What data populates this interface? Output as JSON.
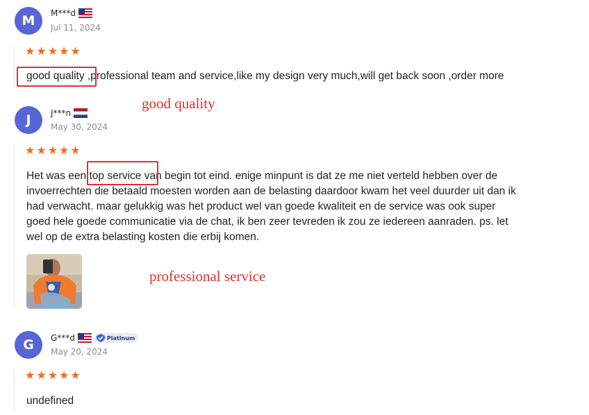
{
  "reviews": [
    {
      "avatar_letter": "M",
      "name": "M***d",
      "flag": "us-flag-icon",
      "date": "Jul 11, 2024",
      "rating": 5,
      "text_highlight": "good quality",
      "text_rest": " ,professional team and service,like my design very much,will get back soon ,order more"
    },
    {
      "avatar_letter": "J",
      "name": "J***n",
      "flag": "nl-flag-icon",
      "date": "May 30, 2024",
      "rating": 5,
      "text_lines": [
        "Het was een top service van begin tot eind. enige minpunt is dat ze me niet verteld hebben over de",
        "invoerrechten die betaald moesten worden aan de belasting daardoor kwam het veel duurder uit dan ik",
        "had verwacht. maar gelukkig was het product wel van goede kwaliteit en de service was ook super",
        "goed hele goede communicatie via de chat, ik ben zeer tevreden ik zou ze iedereen aanraden. ps. let",
        "wel op de extra belasting kosten die erbij komen."
      ],
      "has_photo": true
    },
    {
      "avatar_letter": "G",
      "name": "G***d",
      "flag": "us-flag-icon",
      "badge": "Platinum",
      "date": "May 20, 2024",
      "rating": 5,
      "text": "undefined"
    }
  ],
  "annotations": {
    "first": "good quality",
    "second": "professional service"
  },
  "colors": {
    "avatar": "#5765d6",
    "star": "#f26c18",
    "annotation": "#e03030"
  }
}
